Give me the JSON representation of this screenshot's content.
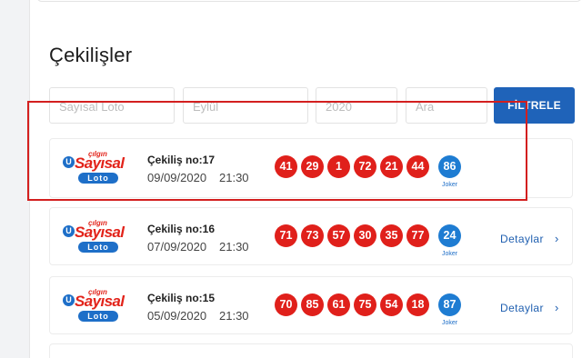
{
  "page": {
    "title": "Çekilişler"
  },
  "filters": {
    "game_placeholder": "Sayısal Loto",
    "month_placeholder": "Eylül",
    "year_placeholder": "2020",
    "search_placeholder": "Ara",
    "button_label": "FİLTRELE"
  },
  "logo": {
    "small": "çılgın",
    "main": "Sayısal",
    "badge": "Loto",
    "mark": "U"
  },
  "draws": [
    {
      "title": "Çekiliş no:17",
      "date": "09/09/2020",
      "time": "21:30",
      "numbers": [
        "41",
        "29",
        "1",
        "72",
        "21",
        "44"
      ],
      "joker": "86",
      "joker_label": "Joker",
      "details": ""
    },
    {
      "title": "Çekiliş no:16",
      "date": "07/09/2020",
      "time": "21:30",
      "numbers": [
        "71",
        "73",
        "57",
        "30",
        "35",
        "77"
      ],
      "joker": "24",
      "joker_label": "Joker",
      "details": "Detaylar"
    },
    {
      "title": "Çekiliş no:15",
      "date": "05/09/2020",
      "time": "21:30",
      "numbers": [
        "70",
        "85",
        "61",
        "75",
        "54",
        "18"
      ],
      "joker": "87",
      "joker_label": "Joker",
      "details": "Detaylar"
    }
  ],
  "colors": {
    "primary": "#1f63b9",
    "ball_red": "#e0201b",
    "ball_blue": "#1e7cd2",
    "highlight": "#d31f1f"
  },
  "icons": {
    "chevron": "chevron-right-icon"
  }
}
